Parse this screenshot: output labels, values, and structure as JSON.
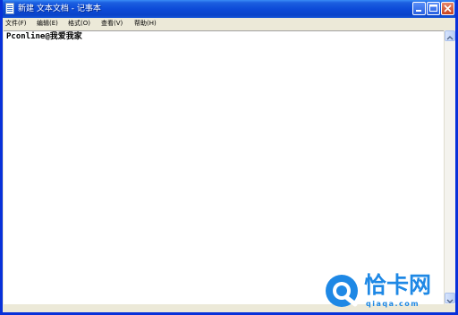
{
  "window": {
    "title": "新建 文本文档 - 记事本"
  },
  "menu": {
    "items": [
      {
        "label": "文件(F)"
      },
      {
        "label": "编辑(E)"
      },
      {
        "label": "格式(O)"
      },
      {
        "label": "查看(V)"
      },
      {
        "label": "帮助(H)"
      }
    ]
  },
  "editor": {
    "content": "Pconline@我爱我家"
  },
  "watermark": {
    "name": "恰卡网",
    "url": "qiaqa.com"
  },
  "icons": {
    "app": "notepad-icon",
    "minimize": "minimize-icon",
    "maximize": "maximize-icon",
    "close": "close-icon",
    "scroll_up": "scroll-up-icon",
    "scroll_down": "scroll-down-icon"
  },
  "colors": {
    "titlebar": "#0a44c8",
    "close_button": "#c84420",
    "watermark": "#1e88e5"
  }
}
